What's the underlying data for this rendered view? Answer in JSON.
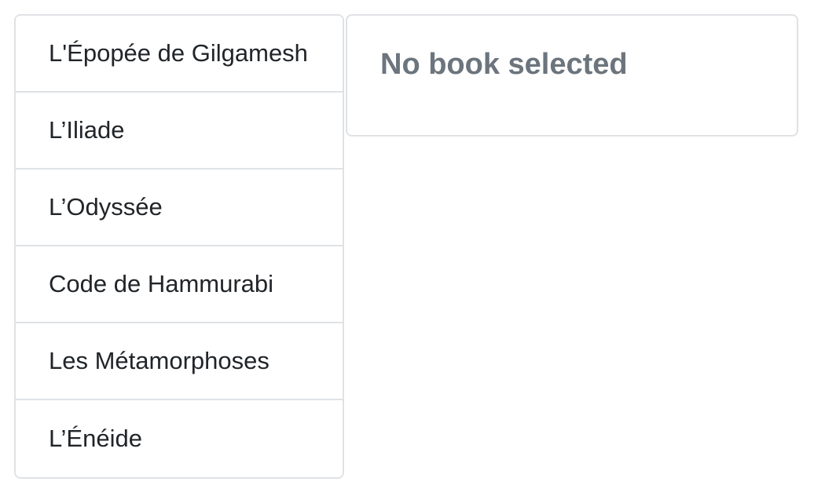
{
  "books": {
    "items": [
      {
        "label": "L'Épopée de Gilgamesh"
      },
      {
        "label": "L’Iliade"
      },
      {
        "label": "L’Odyssée"
      },
      {
        "label": "Code de Hammurabi"
      },
      {
        "label": "Les Métamorphoses"
      },
      {
        "label": "L’Énéide"
      }
    ]
  },
  "detail": {
    "empty_text": "No book selected"
  },
  "colors": {
    "border": "#dfe2e5",
    "text": "#212529",
    "muted_text": "#6c757d",
    "background": "#ffffff"
  }
}
